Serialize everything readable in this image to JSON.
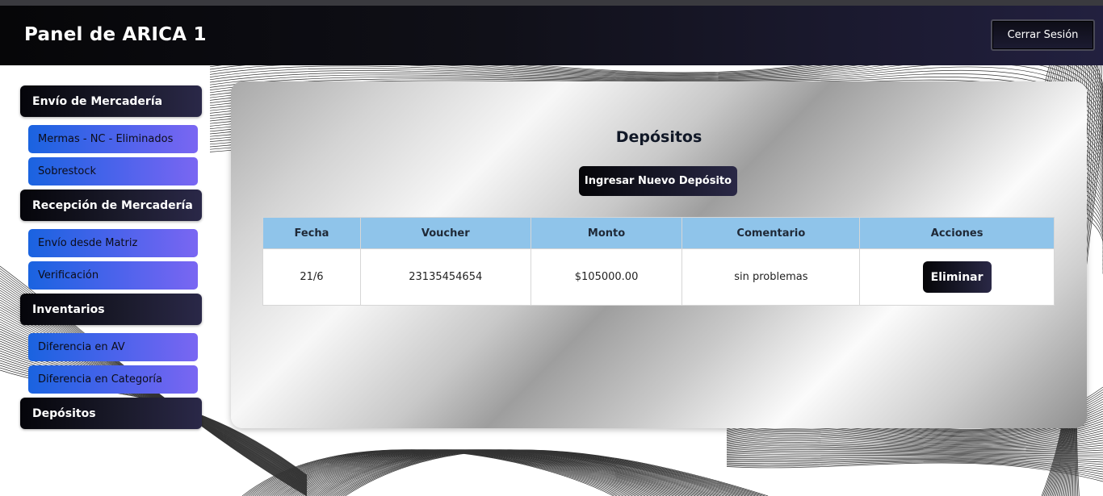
{
  "header": {
    "title": "Panel de ARICA 1",
    "logout_label": "Cerrar Sesión"
  },
  "sidebar": {
    "sections": [
      {
        "label": "Envío de Mercadería",
        "items": [
          {
            "label": "Mermas - NC - Eliminados"
          },
          {
            "label": "Sobrestock"
          }
        ]
      },
      {
        "label": "Recepción de Mercadería",
        "items": [
          {
            "label": "Envío desde Matriz"
          },
          {
            "label": "Verificación"
          }
        ]
      },
      {
        "label": "Inventarios",
        "items": [
          {
            "label": "Diferencia en AV"
          },
          {
            "label": "Diferencia en Categoría"
          }
        ]
      },
      {
        "label": "Depósitos",
        "items": []
      }
    ]
  },
  "main": {
    "title": "Depósitos",
    "new_button_label": "Ingresar Nuevo Depósito",
    "table": {
      "columns": [
        "Fecha",
        "Voucher",
        "Monto",
        "Comentario",
        "Acciones"
      ],
      "rows": [
        {
          "fecha": "21/6",
          "voucher": "23135454654",
          "monto": "$105000.00",
          "comentario": "sin problemas",
          "action_label": "Eliminar"
        }
      ]
    }
  },
  "colors": {
    "header_gradient_start": "#060608",
    "header_gradient_end": "#22203f",
    "submenu_gradient_start": "#1a63e0",
    "submenu_gradient_end": "#7a66f2",
    "table_header": "#8fc4ea"
  }
}
